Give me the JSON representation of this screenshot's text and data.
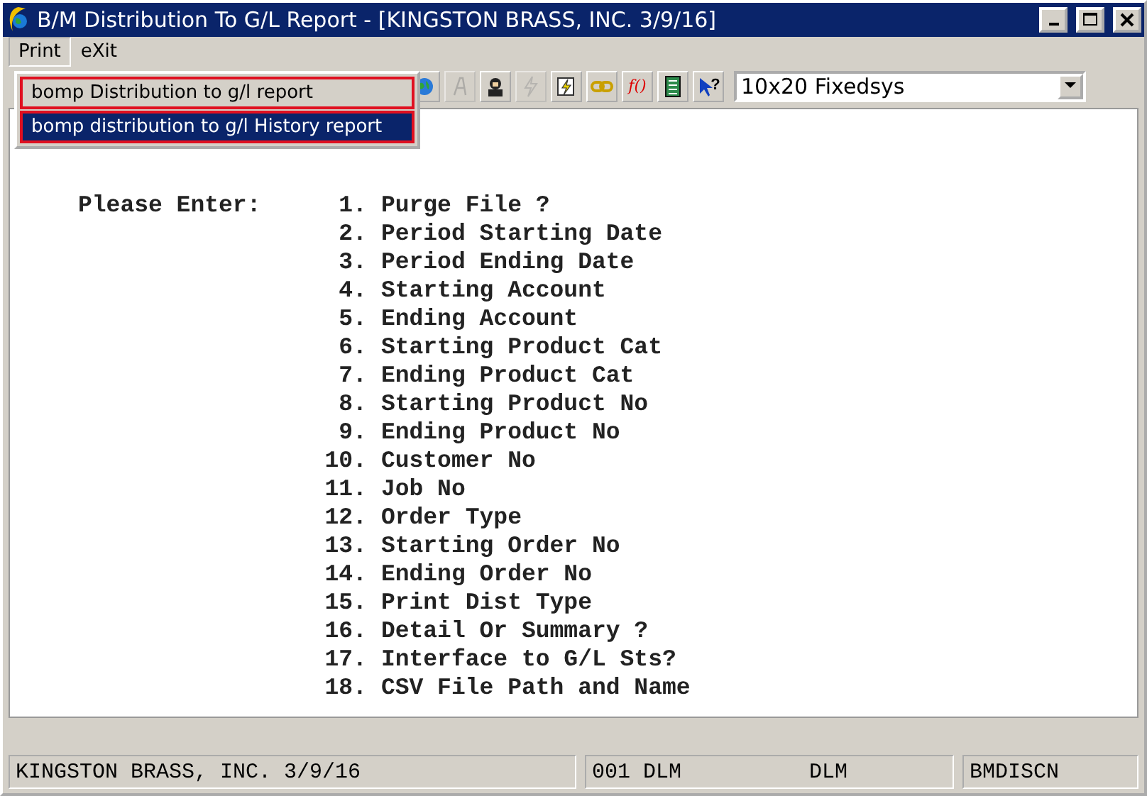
{
  "window": {
    "title": "B/M Distribution To G/L Report - [KINGSTON BRASS, INC. 3/9/16]"
  },
  "menu_bar": [
    {
      "label": "Print",
      "selected": true
    },
    {
      "label": "eXit",
      "selected": false
    }
  ],
  "dropdown": [
    {
      "label": "bomp Distribution to g/l report",
      "selected": false,
      "outlined": true
    },
    {
      "label": "bomp distribution to g/l History report",
      "selected": true,
      "outlined": true
    }
  ],
  "toolbar": [
    {
      "disabled": false
    },
    {
      "disabled": true
    },
    {
      "disabled": false
    },
    {
      "disabled": true
    },
    {
      "disabled": false
    },
    {
      "disabled": false
    },
    {
      "disabled": false,
      "glyph": "f()"
    },
    {
      "disabled": false
    },
    {
      "disabled": false,
      "glyph": "?"
    }
  ],
  "font_select": {
    "value": "10x20 Fixedsys"
  },
  "prompt": "Please Enter:",
  "fields": [
    {
      "number": "1.",
      "label": "Purge File ?"
    },
    {
      "number": "2.",
      "label": "Period Starting Date"
    },
    {
      "number": "3.",
      "label": "Period Ending Date"
    },
    {
      "number": "4.",
      "label": "Starting Account"
    },
    {
      "number": "5.",
      "label": "Ending Account"
    },
    {
      "number": "6.",
      "label": "Starting Product Cat"
    },
    {
      "number": "7.",
      "label": "Ending Product Cat"
    },
    {
      "number": "8.",
      "label": "Starting Product No"
    },
    {
      "number": "9.",
      "label": "Ending Product No"
    },
    {
      "number": "10.",
      "label": "Customer No"
    },
    {
      "number": "11.",
      "label": "Job No"
    },
    {
      "number": "12.",
      "label": "Order Type"
    },
    {
      "number": "13.",
      "label": "Starting Order No"
    },
    {
      "number": "14.",
      "label": "Ending Order No"
    },
    {
      "number": "15.",
      "label": "Print Dist Type"
    },
    {
      "number": "16.",
      "label": "Detail Or Summary ?"
    },
    {
      "number": "17.",
      "label": "Interface to G/L Sts?"
    },
    {
      "number": "18.",
      "label": "CSV File Path and Name"
    }
  ],
  "status_bar": {
    "company": "KINGSTON BRASS, INC. 3/9/16",
    "code": "001 DLM",
    "user": "DLM",
    "program": "BMDISCN"
  }
}
